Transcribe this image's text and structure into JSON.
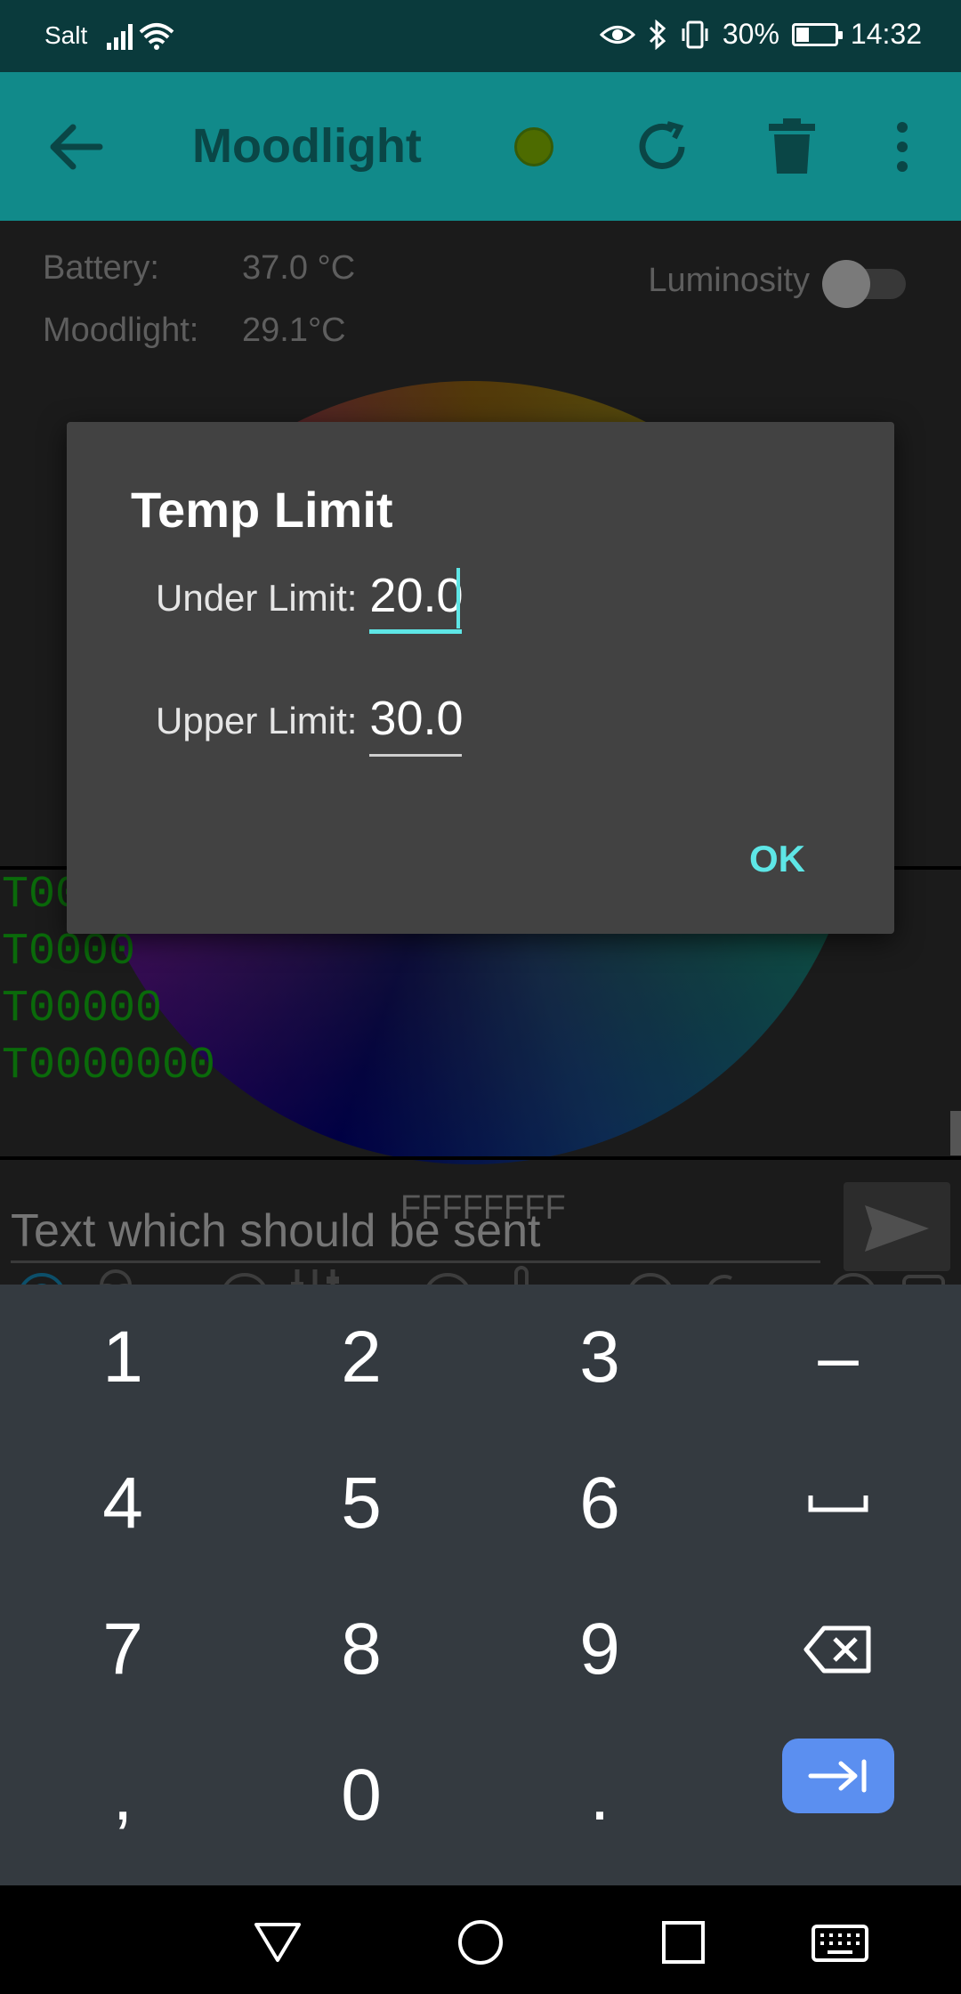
{
  "status_bar": {
    "carrier": "Salt",
    "battery_percent": "30%",
    "battery_level": 0.3,
    "time": "14:32"
  },
  "app_bar": {
    "title": "Moodlight",
    "status_dot_color": "#4d6b00",
    "icons": [
      "back-arrow-icon",
      "refresh-icon",
      "trash-icon",
      "more-vert-icon"
    ]
  },
  "sensors": {
    "battery_label": "Battery:",
    "battery_value": "37.0 °C",
    "moodlight_label": "Moodlight:",
    "moodlight_value": "29.1°C",
    "luminosity_label": "Luminosity",
    "luminosity_on": false
  },
  "log": {
    "lines": [
      "T00",
      "T0000",
      "T00000",
      "T0000000"
    ]
  },
  "hex_value": "FFFFFFFF",
  "send": {
    "placeholder": "Text which should be sent"
  },
  "dialog": {
    "title": "Temp Limit",
    "under_label": "Under Limit:",
    "under_value": "20.0",
    "upper_label": "Upper Limit:",
    "upper_value": "30.0",
    "ok_label": "OK"
  },
  "keyboard": {
    "rows": [
      [
        "1",
        "2",
        "3",
        "–"
      ],
      [
        "4",
        "5",
        "6",
        "space-icon"
      ],
      [
        "7",
        "8",
        "9",
        "backspace-icon"
      ],
      [
        ",",
        "0",
        ".",
        "next-icon"
      ]
    ],
    "k1": "1",
    "k2": "2",
    "k3": "3",
    "kdash": "–",
    "k4": "4",
    "k5": "5",
    "k6": "6",
    "k7": "7",
    "k8": "8",
    "k9": "9",
    "kcomma": ",",
    "k0": "0",
    "kdot": "."
  },
  "colors": {
    "accent": "#5ee6e6",
    "app_bar": "#118a8a",
    "status_bar": "#0a3a3c",
    "keyboard_bg": "#343a40",
    "action_key": "#5b8ff0",
    "log_text": "#0a6a0a"
  }
}
